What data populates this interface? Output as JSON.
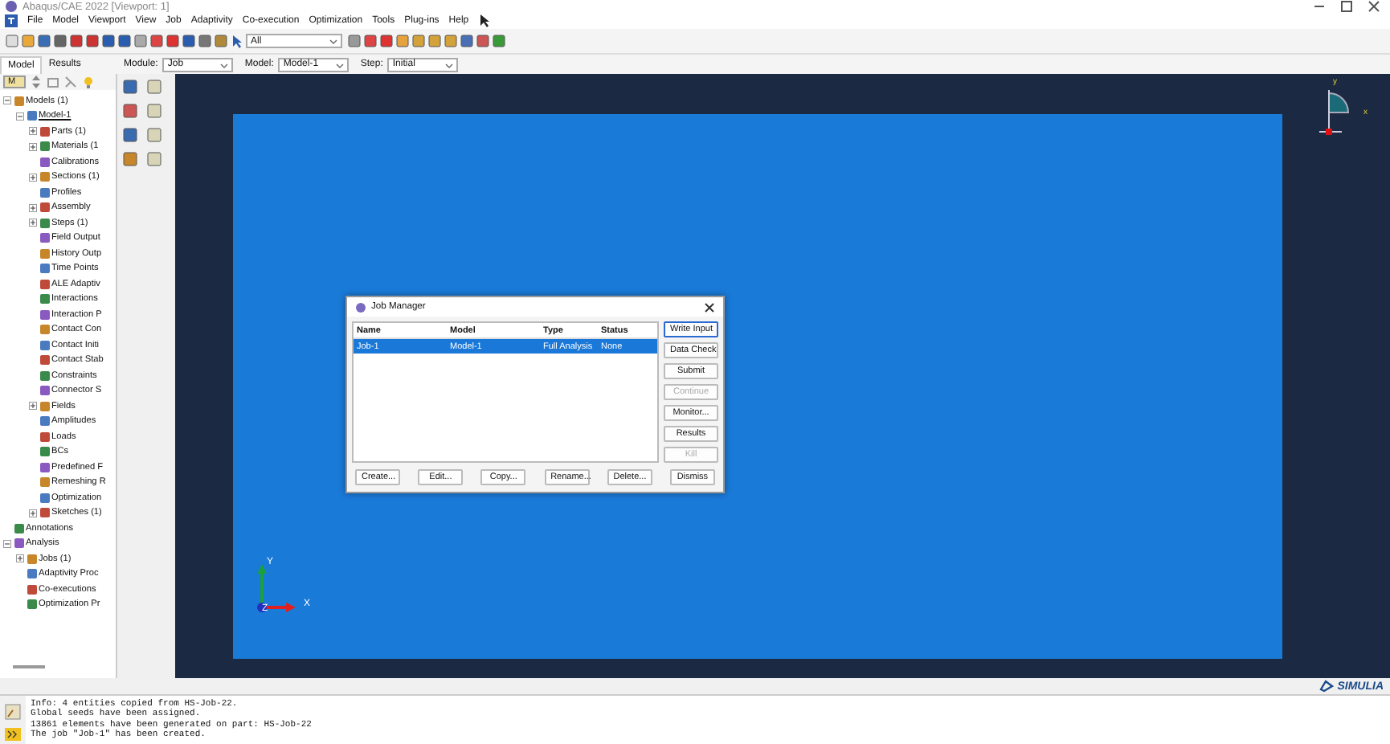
{
  "window": {
    "title": "Abaqus/CAE 2022 [Viewport: 1]"
  },
  "menu": [
    "File",
    "Model",
    "Viewport",
    "View",
    "Job",
    "Adaptivity",
    "Co-execution",
    "Optimization",
    "Tools",
    "Plug-ins",
    "Help"
  ],
  "selection_field": {
    "value": "All"
  },
  "context": [
    {
      "label": "Module:",
      "value": "Job"
    },
    {
      "label": "Model:",
      "value": "Model-1"
    },
    {
      "label": "Step:",
      "value": "Initial"
    }
  ],
  "tabs": [
    {
      "label": "Model",
      "selected": true
    },
    {
      "label": "Results",
      "selected": false
    }
  ],
  "tree_combo": {
    "value": "M"
  },
  "tree": [
    {
      "label": "Models (1)",
      "expanded": true,
      "children": [
        {
          "label": "Model-1",
          "expanded": true,
          "children": [
            {
              "label": "Parts (1)",
              "expanded": false
            },
            {
              "label": "Materials (1",
              "expanded": false
            },
            {
              "label": "Calibrations"
            },
            {
              "label": "Sections (1)",
              "expanded": false
            },
            {
              "label": "Profiles"
            },
            {
              "label": "Assembly",
              "expanded": false
            },
            {
              "label": "Steps (1)",
              "expanded": false
            },
            {
              "label": "Field Output"
            },
            {
              "label": "History Outp"
            },
            {
              "label": "Time Points"
            },
            {
              "label": "ALE Adaptiv"
            },
            {
              "label": "Interactions"
            },
            {
              "label": "Interaction P"
            },
            {
              "label": "Contact Con"
            },
            {
              "label": "Contact Initi"
            },
            {
              "label": "Contact Stab"
            },
            {
              "label": "Constraints"
            },
            {
              "label": "Connector S"
            },
            {
              "label": "Fields",
              "expanded": false
            },
            {
              "label": "Amplitudes"
            },
            {
              "label": "Loads"
            },
            {
              "label": "BCs"
            },
            {
              "label": "Predefined F"
            },
            {
              "label": "Remeshing R"
            },
            {
              "label": "Optimization"
            },
            {
              "label": "Sketches (1)",
              "expanded": false
            }
          ]
        }
      ]
    },
    {
      "label": "Annotations"
    },
    {
      "label": "Analysis",
      "expanded": true,
      "children": [
        {
          "label": "Jobs (1)",
          "expanded": false
        },
        {
          "label": "Adaptivity Proc"
        },
        {
          "label": "Co-executions"
        },
        {
          "label": "Optimization Pr"
        }
      ]
    }
  ],
  "triad": {
    "x": "X",
    "y": "Y",
    "z": "Z"
  },
  "corner_axes": {
    "x": "x",
    "y": "y"
  },
  "job_manager": {
    "title": "Job Manager",
    "columns": [
      "Name",
      "Model",
      "Type",
      "Status"
    ],
    "rows": [
      {
        "cells": [
          "Job-1",
          "Model-1",
          "Full Analysis",
          "None"
        ],
        "selected": true
      }
    ],
    "side_buttons": [
      {
        "label": "Write Input",
        "disabled": false
      },
      {
        "label": "Data Check",
        "disabled": false
      },
      {
        "label": "Submit",
        "disabled": false
      },
      {
        "label": "Continue",
        "disabled": true
      },
      {
        "label": "Monitor...",
        "disabled": false
      },
      {
        "label": "Results",
        "disabled": false
      },
      {
        "label": "Kill",
        "disabled": true
      }
    ],
    "bottom_buttons": [
      "Create...",
      "Edit...",
      "Copy...",
      "Rename...",
      "Delete...",
      "Dismiss"
    ]
  },
  "logo": "SIMULIA",
  "messages": [
    "Info: 4 entities copied from HS-Job-22.",
    "Global seeds have been assigned.",
    "13861 elements have been generated on part: HS-Job-22",
    "The job \"Job-1\" has been created."
  ]
}
